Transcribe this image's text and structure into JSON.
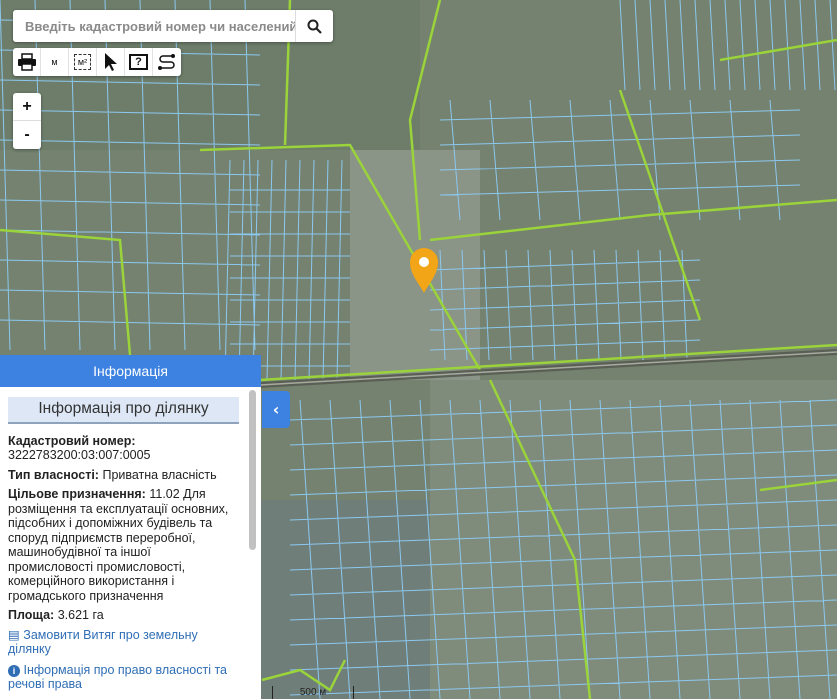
{
  "search": {
    "placeholder": "Введіть кадастровий номер чи населений пункт"
  },
  "tools": [
    {
      "icon": "print-icon"
    },
    {
      "icon": "measure-distance-icon",
      "label": "м"
    },
    {
      "icon": "measure-area-icon",
      "label": "м²"
    },
    {
      "icon": "pointer-icon"
    },
    {
      "icon": "help-monitor-icon",
      "label": "?"
    },
    {
      "icon": "route-icon"
    }
  ],
  "zoom": {
    "in": "+",
    "out": "-"
  },
  "panel": {
    "title": "Інформація",
    "subtitle": "Інформація про ділянку",
    "cadastral_label": "Кадастровий номер:",
    "cadastral_value": "3222783200:03:007:0005",
    "ownership_label": "Тип власності:",
    "ownership_value": "Приватна власність",
    "purpose_label": "Цільове призначення:",
    "purpose_value": "11.02 Для розміщення та експлуатації основних, підсобних і допоміжних будівель та споруд підприємств переробної, машинобудівної та іншої промисловості промисловості, комерційного використання і громадського призначення",
    "area_label": "Площа:",
    "area_value": "3.621 га",
    "link_extract": "Замовити Витяг про земельну ділянку",
    "link_rights": "Інформація про право власності та речові права"
  },
  "scale": "500 м",
  "colors": {
    "accent": "#3d82e0",
    "parcel": "#8cc8f0",
    "boundary": "#9ad33a",
    "marker": "#f2a516"
  }
}
